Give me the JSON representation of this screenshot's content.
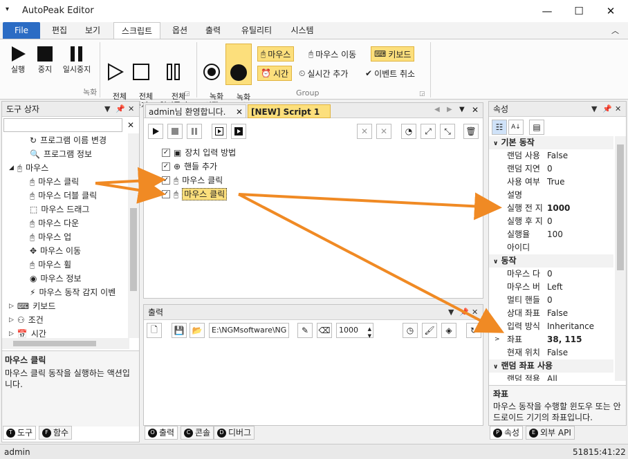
{
  "app": {
    "title": "AutoPeak Editor"
  },
  "menu": {
    "file": "File",
    "tabs": [
      "편집",
      "보기",
      "스크립트",
      "옵션",
      "출력",
      "유틸리티",
      "시스템"
    ]
  },
  "ribbon": {
    "record_group": "녹화",
    "group_group": "Group",
    "run": "실행",
    "stop": "중지",
    "pause": "일시중지",
    "run_all": "전체\n실행",
    "stop_all": "전체\n중지",
    "pause_all": "전체\n일시중지",
    "rec_start": "녹화\n시작",
    "rec_stop": "녹화\n중지",
    "mouse": "마우스",
    "mouse_move": "마우스 이동",
    "keyboard": "키보드",
    "time": "시간",
    "realtime_add": "실시간 추가",
    "event_cancel": "이벤트 취소"
  },
  "toolbox": {
    "title": "도구 상자",
    "items": [
      {
        "label": "프로그램 이름 변경",
        "indent": 2
      },
      {
        "label": "프로그램 정보",
        "indent": 2
      },
      {
        "label": "마우스",
        "indent": 1
      },
      {
        "label": "마우스 클릭",
        "indent": 2
      },
      {
        "label": "마우스 더블 클릭",
        "indent": 2
      },
      {
        "label": "마우스 드래그",
        "indent": 2
      },
      {
        "label": "마우스 다운",
        "indent": 2
      },
      {
        "label": "마우스 업",
        "indent": 2
      },
      {
        "label": "마우스 이동",
        "indent": 2
      },
      {
        "label": "마우스 휠",
        "indent": 2
      },
      {
        "label": "마우스 정보",
        "indent": 2
      },
      {
        "label": "마우스 동작 감지 이벤",
        "indent": 2
      },
      {
        "label": "키보드",
        "indent": 1
      },
      {
        "label": "조건",
        "indent": 1
      },
      {
        "label": "시간",
        "indent": 1
      }
    ],
    "desc_title": "마우스 클릭",
    "desc_text": "마우스 클릭 동작을 실행하는 액션입니다.",
    "tabs": [
      "도구",
      "함수"
    ],
    "tab_badges": [
      "T",
      "F"
    ]
  },
  "editor": {
    "tabs": [
      "admin님 환영합니다.",
      "[NEW] Script 1"
    ],
    "nodes": [
      "장치 입력 방법",
      "핸들 추가",
      "마우스 클릭",
      "마우스 클릭"
    ]
  },
  "output": {
    "title": "출력",
    "path": "E:\\NGMsoftware\\NG",
    "number": "1000",
    "tabs": [
      "출력",
      "콘솔",
      "디버그"
    ],
    "tab_badges": [
      "O",
      "C",
      "D"
    ]
  },
  "properties": {
    "title": "속성",
    "rows": [
      {
        "cat": "기본 동작"
      },
      {
        "k": "랜덤 사용",
        "v": "False"
      },
      {
        "k": "랜덤 지연",
        "v": "0"
      },
      {
        "k": "사용 여부",
        "v": "True"
      },
      {
        "k": "설명",
        "v": ""
      },
      {
        "k": "실행 전 지",
        "v": "1000",
        "bold": true
      },
      {
        "k": "실행 후 지",
        "v": "0"
      },
      {
        "k": "실행율",
        "v": "100"
      },
      {
        "k": "아이디",
        "v": ""
      },
      {
        "cat": "동작"
      },
      {
        "k": "마우스 다",
        "v": "0"
      },
      {
        "k": "마우스 버",
        "v": "Left"
      },
      {
        "k": "멀티 핸들",
        "v": "0"
      },
      {
        "k": "상대 좌표",
        "v": "False"
      },
      {
        "k": "입력 방식",
        "v": "Inheritance"
      },
      {
        "k": "좌표",
        "v": "38, 115",
        "bold": true,
        "expand": true
      },
      {
        "k": "현재 위치",
        "v": "False"
      },
      {
        "cat": "랜덤 좌표 사용"
      },
      {
        "k": "랜덤 적용",
        "v": "All"
      }
    ],
    "desc_title": "좌표",
    "desc_text": "마우스 동작을 수행할 윈도우 또는 안드로이드 기기의 좌표입니다.",
    "tabs": [
      "속성",
      "외부 API"
    ],
    "tab_badges": [
      "P",
      "E"
    ]
  },
  "status": {
    "user": "admin",
    "time": "51815:41:22"
  },
  "colors": {
    "accent": "#2b6cc4",
    "highlight": "#fcdf7c",
    "arrow": "#f08a24"
  }
}
